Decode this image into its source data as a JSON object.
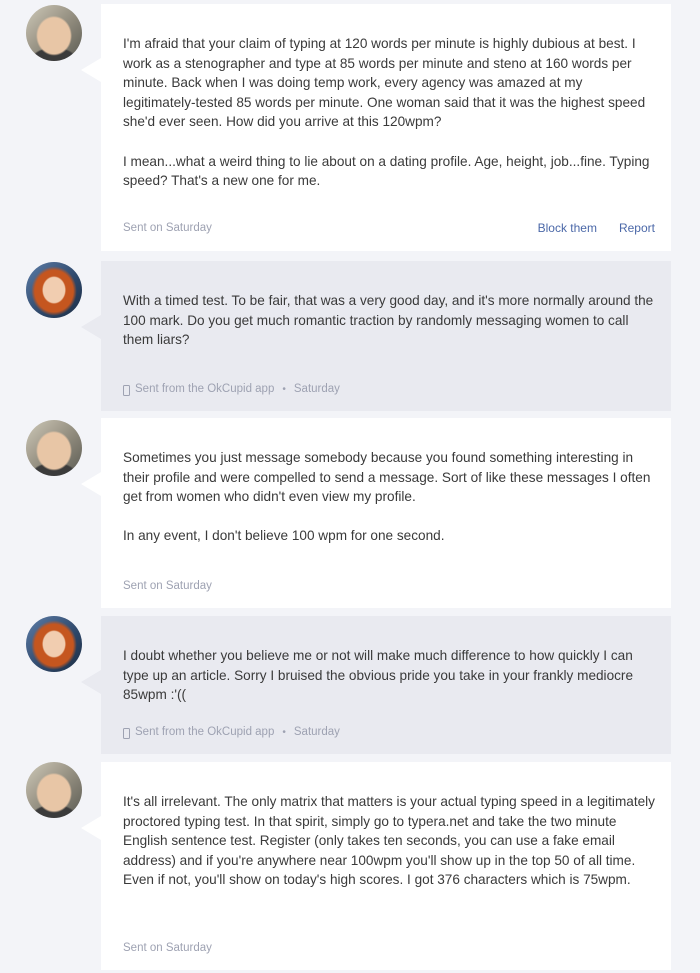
{
  "messages": [
    {
      "sender": "him",
      "style": "white",
      "paragraphs": [
        "I'm afraid that your claim of typing at 120 words per minute is highly dubious at best. I work as a stenographer and type at 85 words per minute and steno at 160 words per minute. Back when I was doing temp work, every agency was amazed at my legitimately-tested 85 words per minute. One woman said that it was the highest speed she'd ever seen. How did you arrive at this 120wpm?",
        "I mean...what a weird thing to lie about on a dating profile. Age, height, job...fine. Typing speed? That's a new one for me."
      ],
      "meta": "Sent on Saturday",
      "actions": {
        "block": "Block them",
        "report": "Report"
      }
    },
    {
      "sender": "her",
      "style": "grey",
      "paragraphs": [
        "With a timed test. To be fair, that was a very good day, and it's more normally around the 100 mark. Do you get much romantic traction by randomly messaging women to call them liars?"
      ],
      "meta_app": "Sent from the OkCupid app",
      "meta_sep": "•",
      "meta_day": "Saturday"
    },
    {
      "sender": "him",
      "style": "white",
      "paragraphs": [
        "Sometimes you just message somebody because you found something interesting in their profile and were compelled to send a message. Sort of like these messages I often get from women who didn't even view my profile.",
        "In any event, I don't believe 100 wpm for one second."
      ],
      "meta": "Sent on Saturday"
    },
    {
      "sender": "her",
      "style": "grey",
      "paragraphs": [
        "I doubt whether you believe me or not will make much difference to how quickly I can type up an article. Sorry I bruised the obvious pride you take in your frankly mediocre 85wpm :'(("
      ],
      "meta_app": "Sent from the OkCupid app",
      "meta_sep": "•",
      "meta_day": "Saturday"
    },
    {
      "sender": "him",
      "style": "white",
      "paragraphs": [
        "It's all irrelevant. The only matrix that matters is your actual typing speed in a legitimately proctored typing test. In that spirit, simply go to typera.net and take the two minute English sentence test. Register (only takes ten seconds, you can use a fake email address) and if you're anywhere near 100wpm you'll show up in the top 50 of all time. Even if not, you'll show on today's high scores. I got 376 characters which is 75wpm."
      ],
      "meta": "Sent on Saturday"
    }
  ]
}
